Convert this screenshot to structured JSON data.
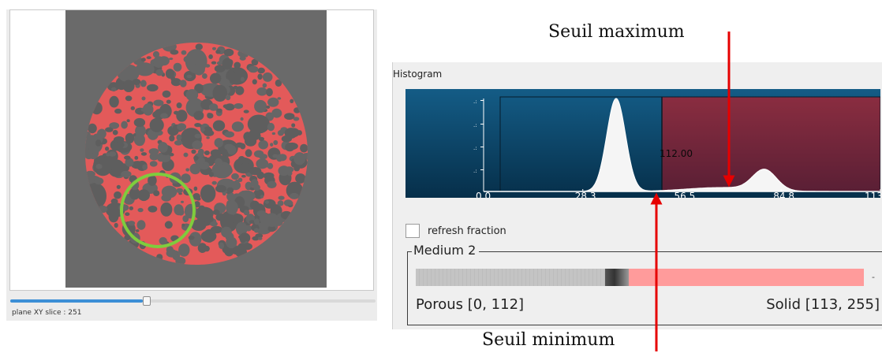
{
  "viewer": {
    "slice_label": "plane XY slice : 251",
    "slice_position": 0.37
  },
  "histogram": {
    "title": "Histogram",
    "threshold_label": "112.00",
    "x_ticks": [
      "0.0",
      "28.3",
      "56.5",
      "84.8",
      "113.0"
    ],
    "colors": {
      "background": "#0a4a6e",
      "selected_region": "#7a2a3e",
      "curve_fill": "#f5f5f5"
    }
  },
  "refresh": {
    "label": "refresh fraction",
    "checked": false
  },
  "medium": {
    "title": "Medium 2",
    "porous_label": "Porous [0, 112]",
    "solid_label": "Solid [113, 255]",
    "dash": "-"
  },
  "annotations": {
    "max": "Seuil maximum",
    "min": "Seuil minimum"
  }
}
